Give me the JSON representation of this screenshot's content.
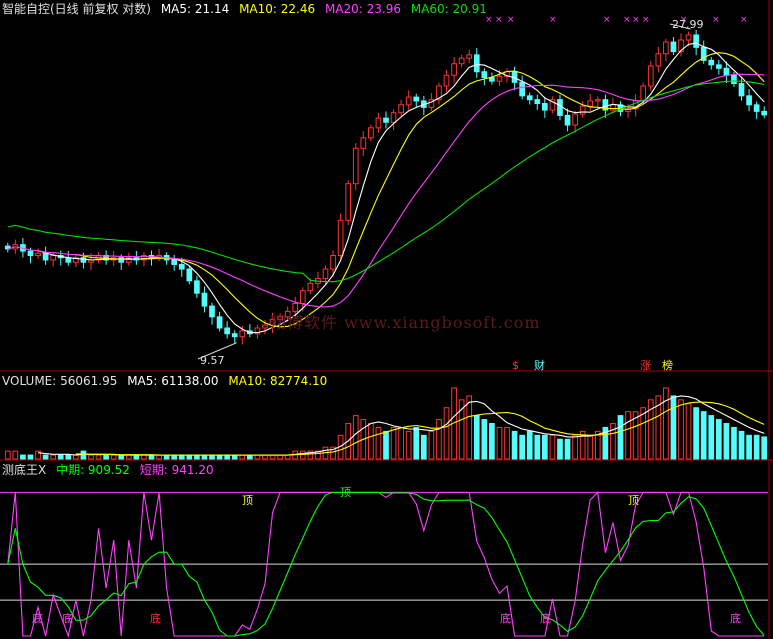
{
  "main_panel": {
    "title": "智能自控(日线 前复权 对数)",
    "ma5": "MA5: 21.14",
    "ma10": "MA10: 22.46",
    "ma20": "MA20: 23.96",
    "ma60": "MA60: 20.91",
    "high_label": "27.99",
    "low_label": "9.57",
    "event_tags": [
      "$",
      "财",
      "涨",
      "榜"
    ],
    "watermark": "翔博软件 www.xiangbosoft.com"
  },
  "volume_panel": {
    "title": "VOLUME: 56061.95",
    "ma5": "MA5: 61138.00",
    "ma10": "MA10: 82774.10"
  },
  "indicator_panel": {
    "title": "测底王X",
    "mid": "中期: 909.52",
    "short": "短期: 941.20",
    "signal_top": "顶",
    "signal_bottom": "底"
  },
  "colors": {
    "up": "#ff3232",
    "down": "#54fcfc",
    "ma5": "#ffffff",
    "ma10": "#ffff00",
    "ma20": "#ff40ff",
    "ma60": "#00e000",
    "mid_line": "#ff40ff",
    "short_line": "#00ff00",
    "axis_red": "#a00000",
    "marker": "#ff40ff"
  },
  "chart_data": {
    "type": "candlestick",
    "series": [
      {
        "name": "MA5",
        "value": 21.14
      },
      {
        "name": "MA10",
        "value": 22.46
      },
      {
        "name": "MA20",
        "value": 23.96
      },
      {
        "name": "MA60",
        "value": 20.91
      }
    ],
    "close": [
      13.2,
      13.4,
      13.1,
      12.9,
      13.0,
      12.7,
      12.9,
      12.8,
      12.6,
      12.8,
      12.6,
      12.7,
      12.9,
      12.7,
      12.8,
      12.6,
      12.8,
      12.7,
      12.9,
      12.8,
      12.9,
      12.7,
      12.5,
      12.3,
      11.8,
      11.3,
      10.8,
      10.4,
      10.0,
      9.8,
      9.7,
      9.9,
      9.8,
      10.0,
      10.1,
      10.3,
      10.4,
      10.6,
      10.9,
      11.4,
      11.7,
      11.9,
      12.3,
      12.9,
      14.6,
      16.6,
      18.8,
      19.5,
      20.2,
      20.9,
      20.6,
      21.3,
      21.9,
      22.5,
      22.2,
      21.7,
      22.3,
      23.4,
      24.3,
      25.3,
      25.8,
      26.1,
      24.6,
      24.1,
      23.8,
      24.2,
      24.6,
      23.7,
      22.6,
      22.3,
      22.0,
      21.5,
      22.3,
      21.1,
      20.4,
      21.2,
      21.8,
      22.2,
      22.3,
      21.5,
      21.9,
      21.4,
      21.6,
      22.2,
      23.4,
      25.1,
      26.2,
      27.3,
      26.4,
      27.5,
      27.99,
      26.8,
      25.6,
      25.2,
      24.9,
      24.3,
      23.6,
      22.6,
      21.9,
      21.4,
      21.14
    ],
    "volume": [
      2,
      2,
      1,
      1,
      2,
      1,
      1,
      1,
      1,
      1,
      2,
      1,
      1,
      1,
      1,
      1,
      1,
      1,
      1,
      1,
      1,
      1,
      1,
      1,
      1,
      1,
      1,
      1,
      1,
      1,
      1,
      1,
      1,
      1,
      1,
      1,
      1,
      1,
      2,
      2,
      2,
      2,
      3,
      3,
      6,
      9,
      11,
      10,
      9,
      8,
      7,
      8,
      8,
      7,
      8,
      6,
      7,
      10,
      13,
      18,
      15,
      16,
      11,
      10,
      9,
      8,
      8,
      7,
      6,
      7,
      6,
      6,
      6,
      5,
      5,
      6,
      7,
      6,
      7,
      8,
      9,
      11,
      12,
      12,
      13,
      15,
      16,
      18,
      16,
      15,
      14,
      13,
      12,
      11,
      10,
      9,
      8,
      7,
      6,
      6,
      5.6
    ],
    "volume_unit_scale": 10000,
    "indicator": {
      "mid": 909.52,
      "short": 941.2,
      "reference_lines": [
        1000,
        500,
        250
      ]
    }
  }
}
